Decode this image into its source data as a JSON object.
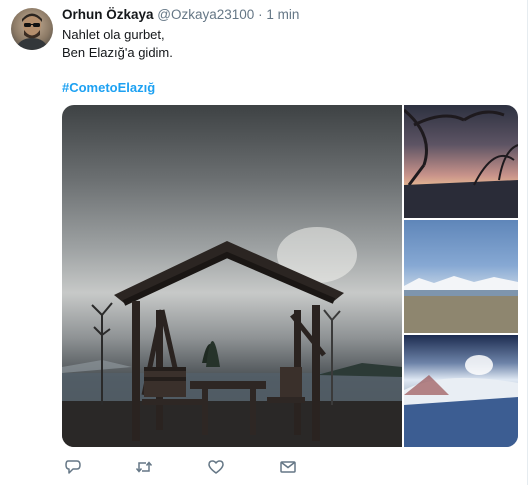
{
  "tweet": {
    "display_name": "Orhun Özkaya",
    "handle": "@Ozkaya23100",
    "separator": "·",
    "time": "1 min",
    "text_lines": [
      "Nahlet ola gurbet,",
      "Ben Elazığ'a gidim."
    ],
    "hashtag": "#CometoElazığ"
  },
  "media": {
    "images": [
      "gazebo-lakeside-photo",
      "sunset-lake-photo",
      "snowy-mountains-lake-photo",
      "snowy-hill-sky-photo"
    ]
  },
  "actions": {
    "icons": [
      "reply-icon",
      "retweet-icon",
      "like-icon",
      "message-icon"
    ]
  },
  "colors": {
    "link": "#1da1f2",
    "secondary_text": "#657786",
    "primary_text": "#14171a",
    "divider": "#e6ecf0"
  }
}
